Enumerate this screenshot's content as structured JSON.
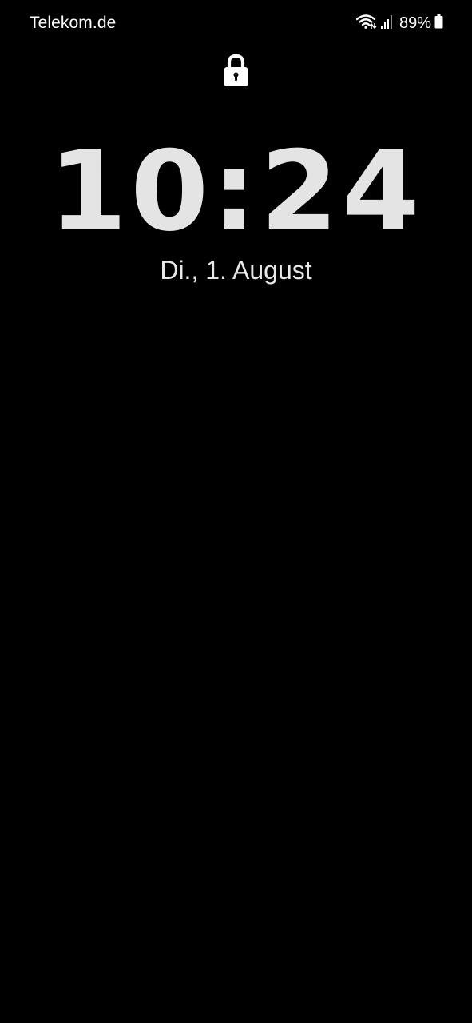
{
  "status_bar": {
    "carrier": "Telekom.de",
    "battery_percent": "89%",
    "icons": [
      "wifi-icon",
      "cellular-signal-icon",
      "battery-icon"
    ]
  },
  "lock_screen": {
    "lock_icon": "lock-icon",
    "time": "10:24",
    "date": "Di., 1. August"
  },
  "colors": {
    "background": "#000000",
    "text": "#ffffff",
    "clock": "#e4e4e4"
  }
}
